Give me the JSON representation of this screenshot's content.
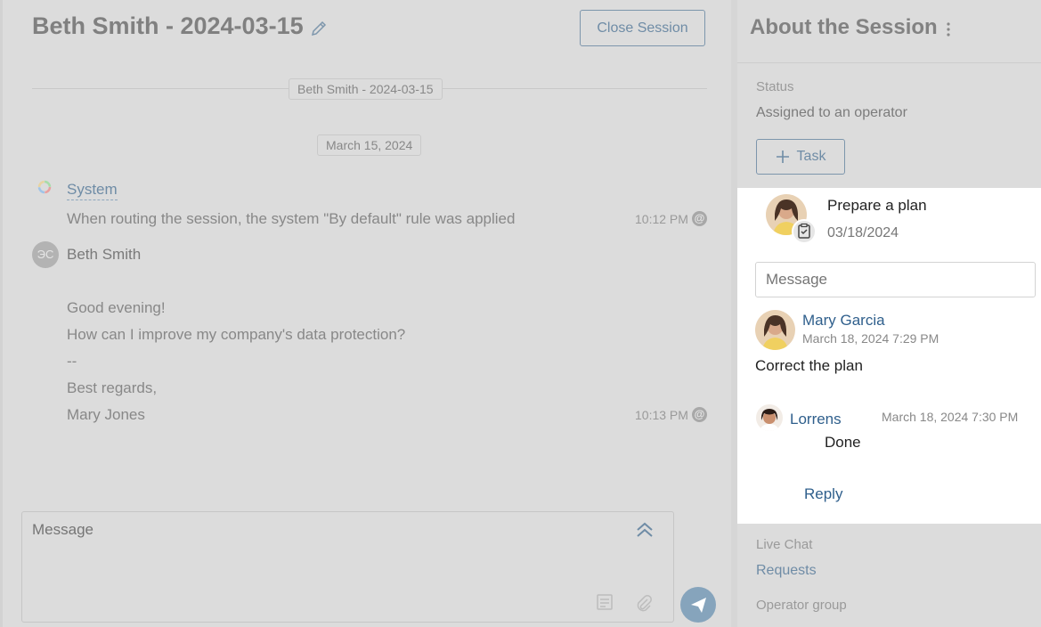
{
  "chat": {
    "title": "Beth Smith - 2024-03-15",
    "close_label": "Close Session",
    "session_pill": "Beth Smith - 2024-03-15",
    "date_pill": "March 15, 2024",
    "messages": [
      {
        "sender": "System",
        "text": "When routing the session, the system \"By default\" rule was applied",
        "time": "10:12 PM"
      },
      {
        "sender": "Beth Smith",
        "initials": "ЭС",
        "lines": [
          "Good evening!",
          "How can I improve my company's data protection?",
          "--",
          "Best regards,",
          "Mary Jones"
        ],
        "time": "10:13 PM"
      }
    ],
    "composer_placeholder": "Message"
  },
  "side": {
    "title": "About the Session",
    "status_label": "Status",
    "status_value": "Assigned to an operator",
    "task_label": "Task",
    "task": {
      "name": "Prepare a plan",
      "date": "03/18/2024",
      "message_placeholder": "Message",
      "comments": [
        {
          "author": "Mary Garcia",
          "time": "March 18, 2024 7:29 PM",
          "text": "Correct the plan"
        },
        {
          "author": "Lorrens",
          "time": "March 18, 2024 7:30 PM",
          "text": "Done"
        }
      ],
      "reply_label": "Reply"
    },
    "live_chat_label": "Live Chat",
    "live_chat_value": "Requests",
    "operator_group_label": "Operator group"
  }
}
